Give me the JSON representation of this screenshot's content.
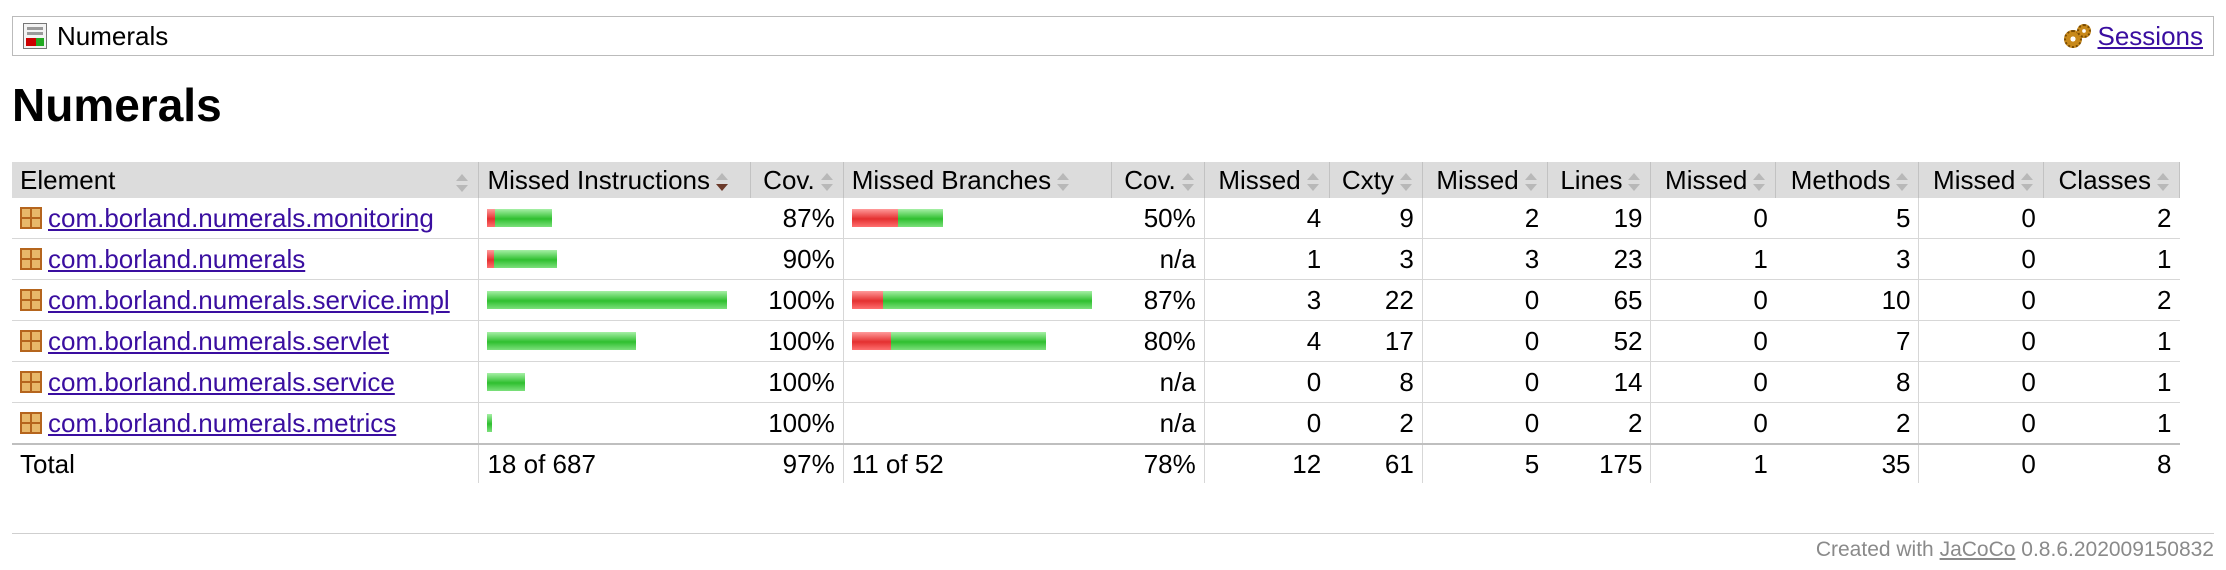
{
  "breadcrumb": {
    "title": "Numerals",
    "report_icon": "report-icon",
    "sessions_label": "Sessions",
    "sessions_icon": "gears-icon"
  },
  "page_title": "Numerals",
  "table": {
    "headers": {
      "element": "Element",
      "missed_instructions": "Missed Instructions",
      "cov_instructions": "Cov.",
      "missed_branches": "Missed Branches",
      "cov_branches": "Cov.",
      "missed_cxty": "Missed",
      "cxty": "Cxty",
      "missed_lines": "Missed",
      "lines": "Lines",
      "missed_methods": "Missed",
      "methods": "Methods",
      "missed_classes": "Missed",
      "classes": "Classes"
    },
    "rows": [
      {
        "name": "com.borland.numerals.monitoring",
        "instr_cov": "87%",
        "branch_cov": "50%",
        "missed_cxty": "4",
        "cxty": "9",
        "missed_lines": "2",
        "lines": "19",
        "missed_methods": "0",
        "methods": "5",
        "missed_classes": "0",
        "classes": "2"
      },
      {
        "name": "com.borland.numerals",
        "instr_cov": "90%",
        "branch_cov": "n/a",
        "missed_cxty": "1",
        "cxty": "3",
        "missed_lines": "3",
        "lines": "23",
        "missed_methods": "1",
        "methods": "3",
        "missed_classes": "0",
        "classes": "1"
      },
      {
        "name": "com.borland.numerals.service.impl",
        "instr_cov": "100%",
        "branch_cov": "87%",
        "missed_cxty": "3",
        "cxty": "22",
        "missed_lines": "0",
        "lines": "65",
        "missed_methods": "0",
        "methods": "10",
        "missed_classes": "0",
        "classes": "2"
      },
      {
        "name": "com.borland.numerals.servlet",
        "instr_cov": "100%",
        "branch_cov": "80%",
        "missed_cxty": "4",
        "cxty": "17",
        "missed_lines": "0",
        "lines": "52",
        "missed_methods": "0",
        "methods": "7",
        "missed_classes": "0",
        "classes": "1"
      },
      {
        "name": "com.borland.numerals.service",
        "instr_cov": "100%",
        "branch_cov": "n/a",
        "missed_cxty": "0",
        "cxty": "8",
        "missed_lines": "0",
        "lines": "14",
        "missed_methods": "0",
        "methods": "8",
        "missed_classes": "0",
        "classes": "1"
      },
      {
        "name": "com.borland.numerals.metrics",
        "instr_cov": "100%",
        "branch_cov": "n/a",
        "missed_cxty": "0",
        "cxty": "2",
        "missed_lines": "0",
        "lines": "2",
        "missed_methods": "0",
        "methods": "2",
        "missed_classes": "0",
        "classes": "1"
      }
    ],
    "instruction_bars": [
      {
        "missed_fraction": 0.13,
        "covered_fraction": 0.87,
        "relative_size": 0.27
      },
      {
        "missed_fraction": 0.1,
        "covered_fraction": 0.9,
        "relative_size": 0.29
      },
      {
        "missed_fraction": 0.0,
        "covered_fraction": 1.0,
        "relative_size": 1.0
      },
      {
        "missed_fraction": 0.0,
        "covered_fraction": 1.0,
        "relative_size": 0.62
      },
      {
        "missed_fraction": 0.0,
        "covered_fraction": 1.0,
        "relative_size": 0.16
      },
      {
        "missed_fraction": 0.0,
        "covered_fraction": 1.0,
        "relative_size": 0.02
      }
    ],
    "branch_bars": [
      {
        "missed_fraction": 0.5,
        "covered_fraction": 0.5,
        "relative_size": 0.38
      },
      null,
      {
        "missed_fraction": 0.13,
        "covered_fraction": 0.87,
        "relative_size": 1.0
      },
      {
        "missed_fraction": 0.2,
        "covered_fraction": 0.8,
        "relative_size": 0.81
      },
      null,
      null
    ],
    "total": {
      "label": "Total",
      "instr": "18 of 687",
      "instr_cov": "97%",
      "branch": "11 of 52",
      "branch_cov": "78%",
      "missed_cxty": "12",
      "cxty": "61",
      "missed_lines": "5",
      "lines": "175",
      "missed_methods": "1",
      "methods": "35",
      "missed_classes": "0",
      "classes": "8"
    }
  },
  "footer": {
    "prefix": "Created with",
    "link": "JaCoCo",
    "version": "0.8.6.202009150832"
  },
  "colors": {
    "link": "#3a0ea0",
    "bar_missed": "#e43030",
    "bar_covered": "#2fbf2f",
    "header_bg": "#dcdcdc"
  }
}
